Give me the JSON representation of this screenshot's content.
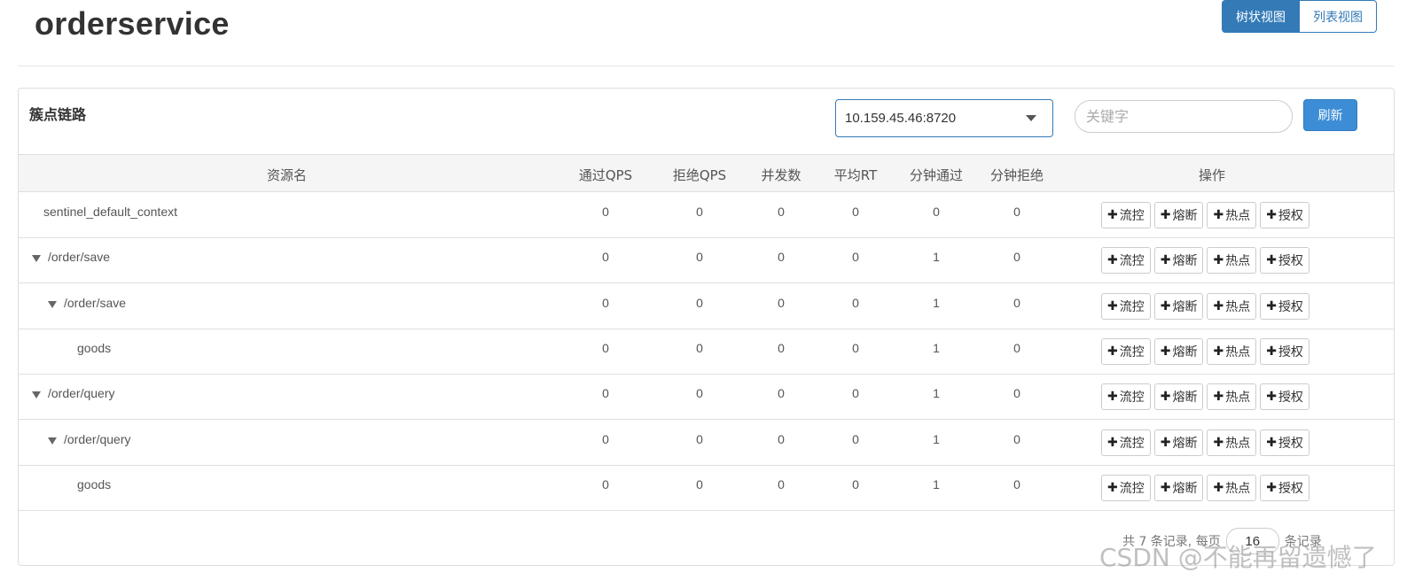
{
  "header": {
    "title": "orderservice",
    "view_tree_label": "树状视图",
    "view_list_label": "列表视图"
  },
  "panel": {
    "title": "簇点链路",
    "machine_value": "10.159.45.46:8720",
    "search_placeholder": "关键字",
    "refresh_label": "刷新"
  },
  "table": {
    "columns": [
      "资源名",
      "通过QPS",
      "拒绝QPS",
      "并发数",
      "平均RT",
      "分钟通过",
      "分钟拒绝",
      "操作"
    ],
    "action_labels": [
      "流控",
      "熔断",
      "热点",
      "授权"
    ],
    "rows": [
      {
        "name": "sentinel_default_context",
        "level": 0,
        "expandable": false,
        "pass_qps": "0",
        "block_qps": "0",
        "concurrency": "0",
        "avg_rt": "0",
        "minute_pass": "0",
        "minute_block": "0"
      },
      {
        "name": "/order/save",
        "level": 0,
        "expandable": true,
        "pass_qps": "0",
        "block_qps": "0",
        "concurrency": "0",
        "avg_rt": "0",
        "minute_pass": "1",
        "minute_block": "0"
      },
      {
        "name": "/order/save",
        "level": 1,
        "expandable": true,
        "pass_qps": "0",
        "block_qps": "0",
        "concurrency": "0",
        "avg_rt": "0",
        "minute_pass": "1",
        "minute_block": "0"
      },
      {
        "name": "goods",
        "level": 2,
        "expandable": false,
        "pass_qps": "0",
        "block_qps": "0",
        "concurrency": "0",
        "avg_rt": "0",
        "minute_pass": "1",
        "minute_block": "0"
      },
      {
        "name": "/order/query",
        "level": 0,
        "expandable": true,
        "pass_qps": "0",
        "block_qps": "0",
        "concurrency": "0",
        "avg_rt": "0",
        "minute_pass": "1",
        "minute_block": "0"
      },
      {
        "name": "/order/query",
        "level": 1,
        "expandable": true,
        "pass_qps": "0",
        "block_qps": "0",
        "concurrency": "0",
        "avg_rt": "0",
        "minute_pass": "1",
        "minute_block": "0"
      },
      {
        "name": "goods",
        "level": 2,
        "expandable": false,
        "pass_qps": "0",
        "block_qps": "0",
        "concurrency": "0",
        "avg_rt": "0",
        "minute_pass": "1",
        "minute_block": "0"
      }
    ]
  },
  "pagination": {
    "total_text": "共 7 条记录, 每页",
    "page_size": "16",
    "suffix_text": "条记录"
  },
  "watermark": "CSDN @不能再留遗憾了",
  "icons": {
    "plus": "plus-icon",
    "caret": "caret-down-icon",
    "select_caret": "chevron-down-icon"
  },
  "colors": {
    "primary": "#337ab7",
    "refresh": "#3c8dd5",
    "header_bg": "#f5f5f5"
  }
}
